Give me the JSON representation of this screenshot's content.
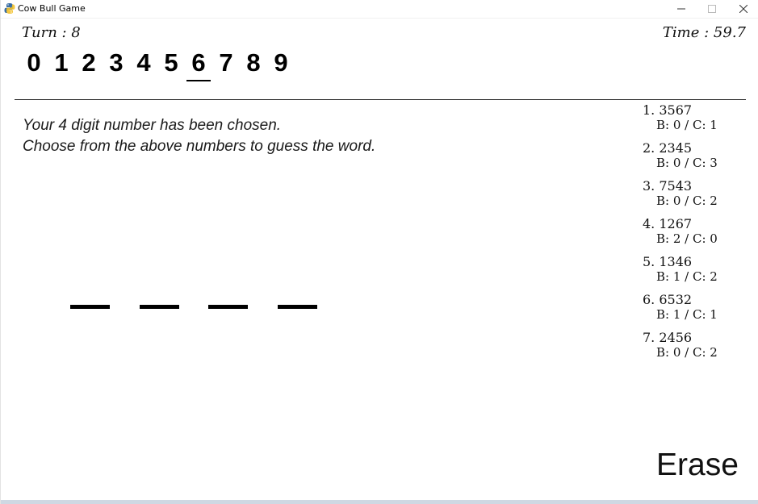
{
  "window": {
    "title": "Cow Bull Game",
    "icons": {
      "app": "python-icon",
      "minimize": "minimize-icon",
      "maximize": "maximize-icon",
      "close": "close-icon"
    }
  },
  "game": {
    "turn_text": "Turn : 8",
    "time_text": "Time : 59.7",
    "digits": [
      "0",
      "1",
      "2",
      "3",
      "4",
      "5",
      "6",
      "7",
      "8",
      "9"
    ],
    "selected_digit": "6",
    "message_line1": "Your 4 digit number has been chosen.",
    "message_line2": "Choose from the above numbers to guess the word.",
    "slot_count": 4,
    "erase_label": "Erase"
  },
  "history": [
    {
      "entry": "1. 3567",
      "result": "B: 0 / C: 1"
    },
    {
      "entry": "2. 2345",
      "result": "B: 0 / C: 3"
    },
    {
      "entry": "3. 7543",
      "result": "B: 0 / C: 2"
    },
    {
      "entry": "4. 1267",
      "result": "B: 2 / C: 0"
    },
    {
      "entry": "5. 1346",
      "result": "B: 1 / C: 2"
    },
    {
      "entry": "6. 6532",
      "result": "B: 1 / C: 1"
    },
    {
      "entry": "7. 2456",
      "result": "B: 0 / C: 2"
    }
  ],
  "colors": {
    "text": "#111111",
    "background": "#ffffff",
    "divider": "#333333"
  }
}
